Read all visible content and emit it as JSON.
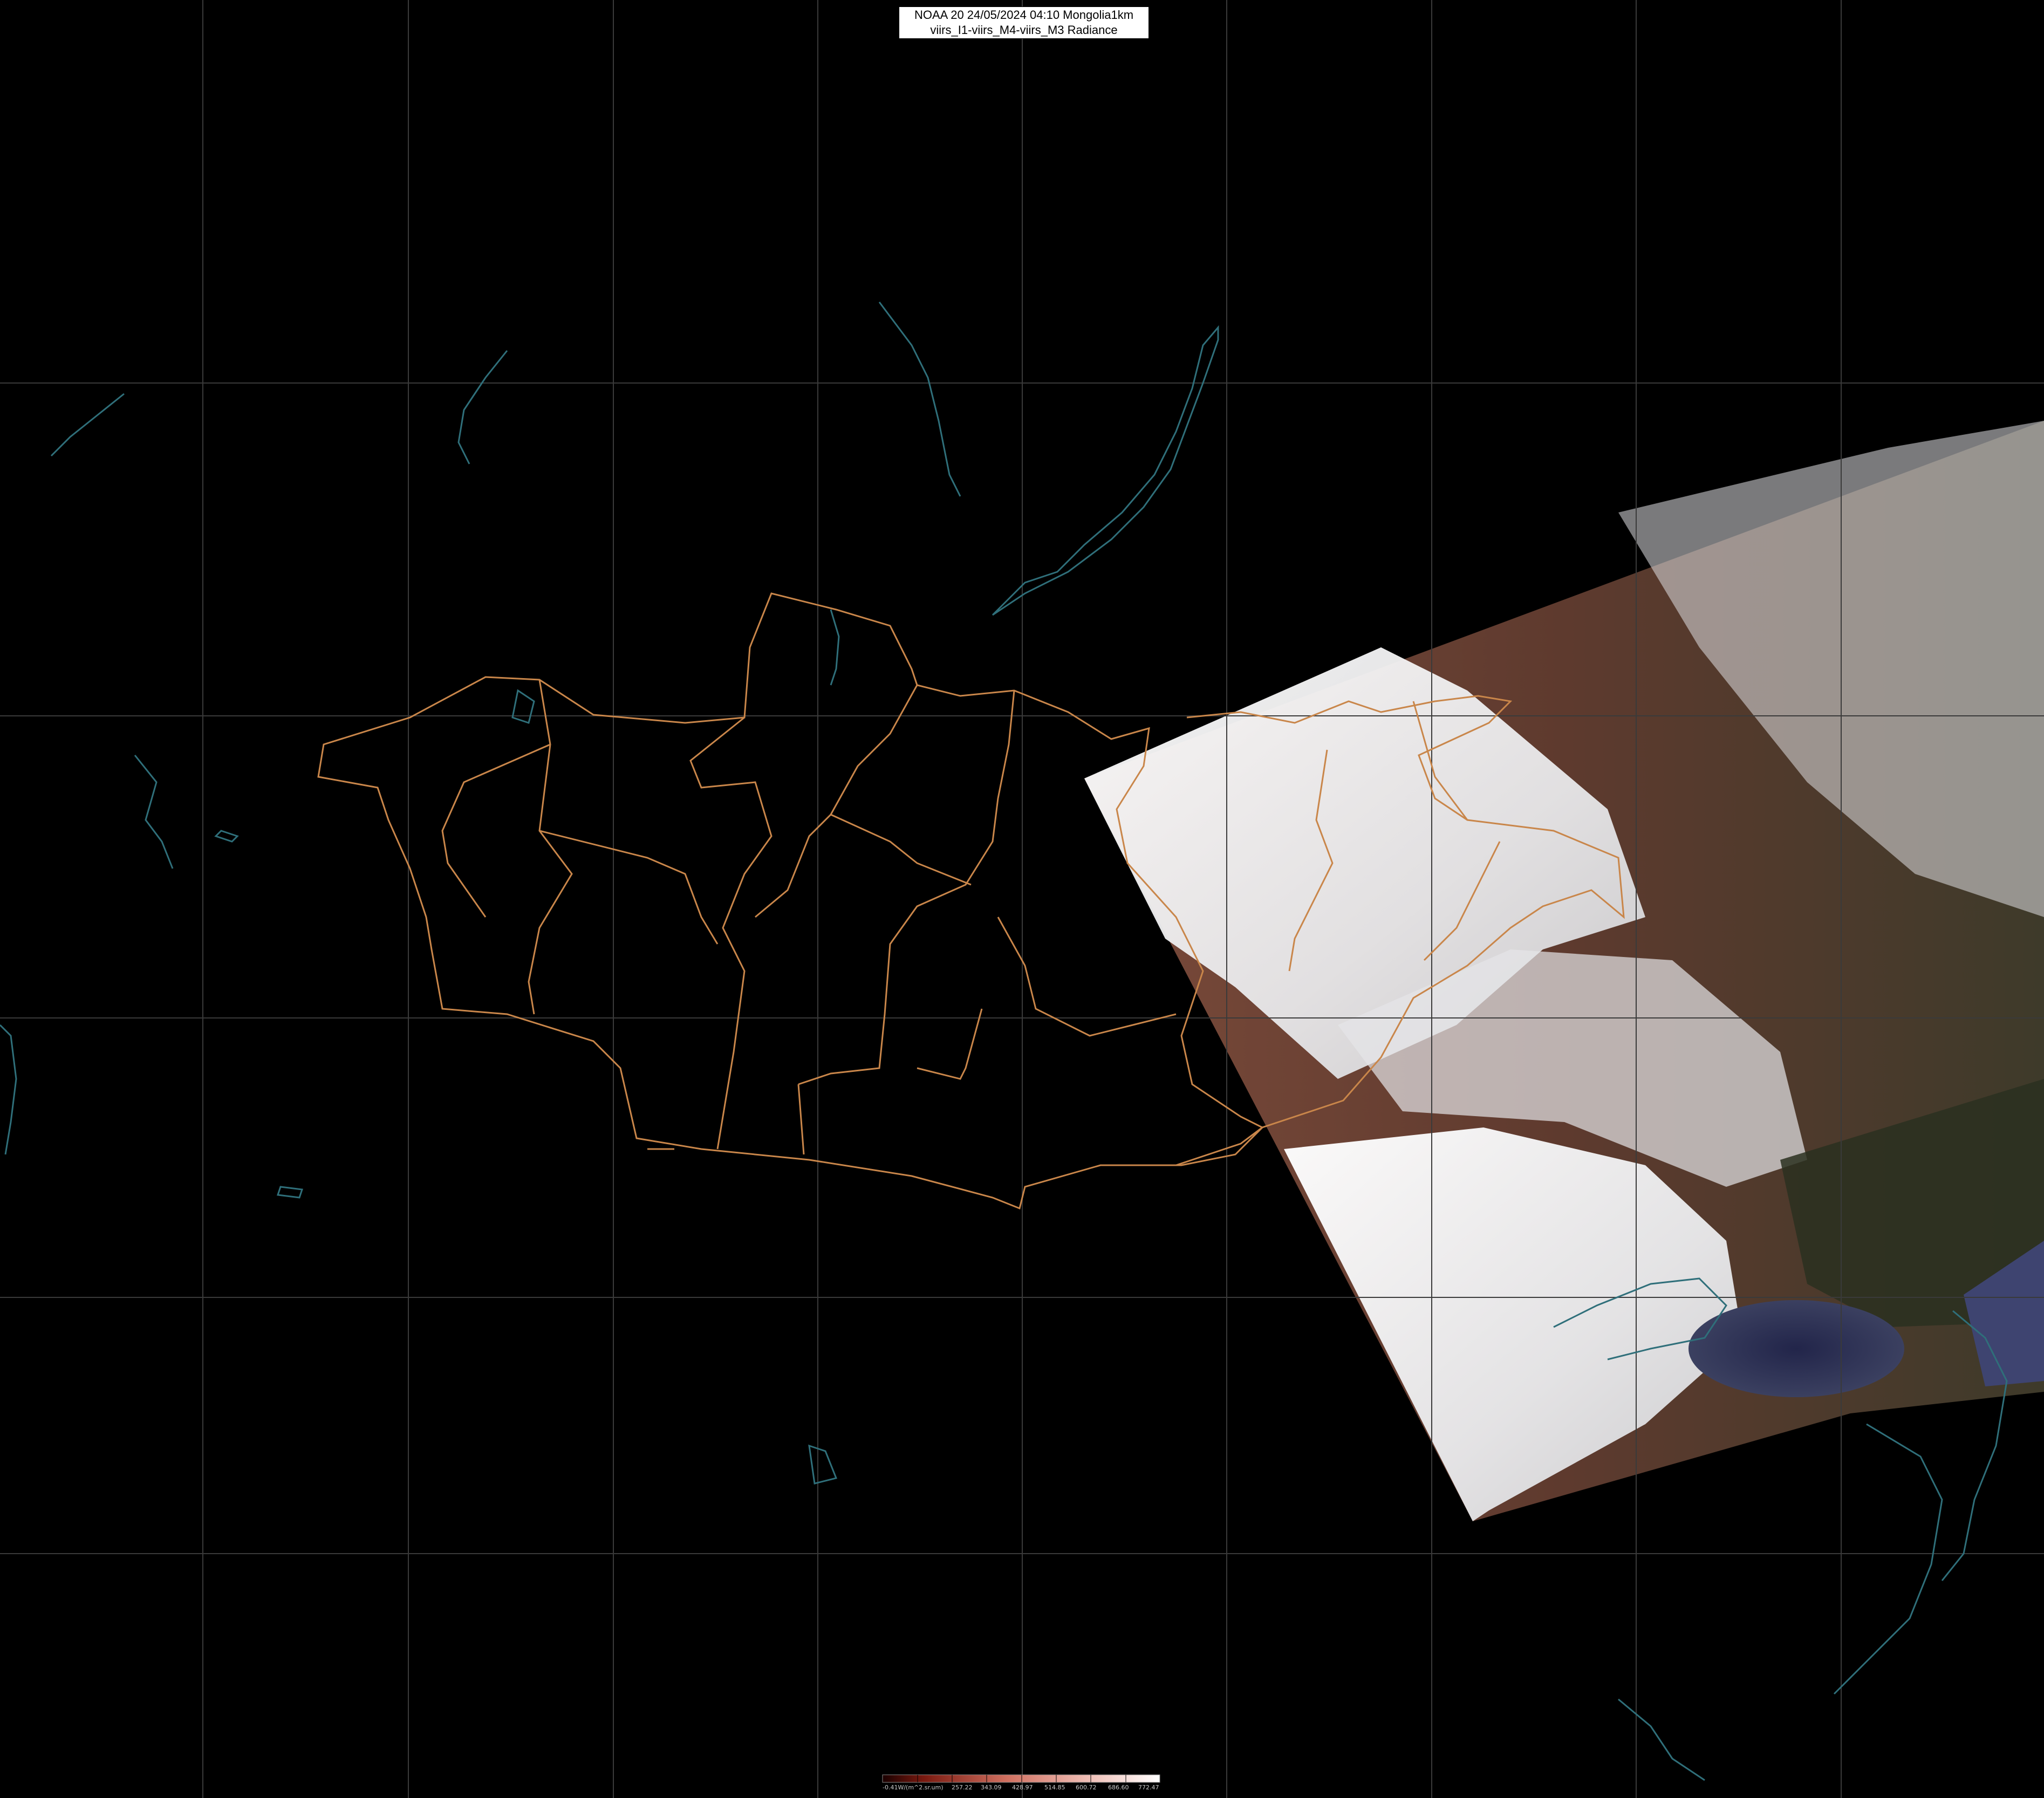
{
  "header": {
    "line1": "NOAA 20 24/05/2024 04:10 Mongolia1km",
    "line2": "viirs_I1-viirs_M4-viirs_M3 Radiance"
  },
  "colors": {
    "background": "#000000",
    "graticule": "#3a3a3a",
    "admin_borders": "#c9864a",
    "coastlines_rivers": "#2f6f7a",
    "legend_start": "#2a0000",
    "legend_end": "#ffffff"
  },
  "legend": {
    "labels": [
      "-0.41W/(m^2.sr.um)",
      "257.22",
      "343.09",
      "428.97",
      "514.85",
      "600.72",
      "686.60",
      "772.47"
    ]
  }
}
